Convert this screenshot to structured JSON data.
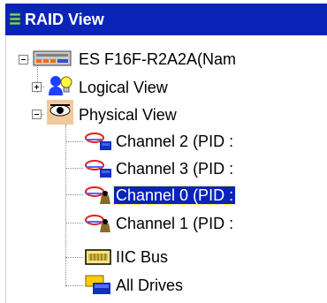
{
  "panel": {
    "title": "RAID View"
  },
  "tree": {
    "root": {
      "label": "ES F16F-R2A2A(Nam"
    },
    "logical": {
      "label": "Logical View"
    },
    "physical": {
      "label": "Physical View"
    },
    "channels": [
      {
        "label": "Channel 2 (PID :"
      },
      {
        "label": "Channel 3 (PID :"
      },
      {
        "label": "Channel 0 (PID :"
      },
      {
        "label": "Channel 1 (PID :"
      }
    ],
    "iic": {
      "label": "IIC Bus"
    },
    "drives": {
      "label": "All Drives"
    },
    "selected": "Channel 0 (PID :"
  }
}
